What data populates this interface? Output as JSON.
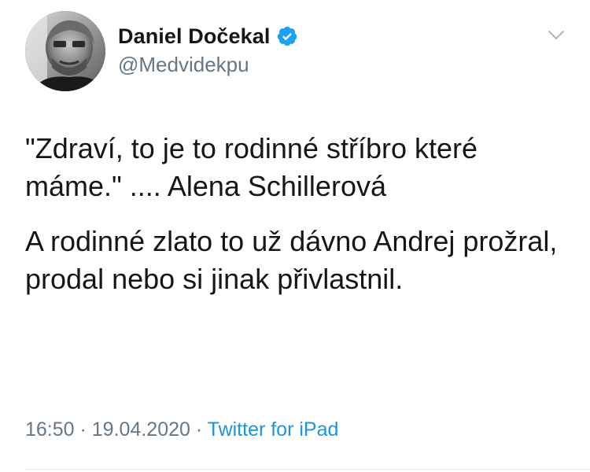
{
  "author": {
    "display_name": "Daniel Dočekal",
    "handle": "@Medvidekpu",
    "verified": true
  },
  "icons": {
    "verified": "verified-badge-icon",
    "menu": "chevron-down-icon"
  },
  "tweet": {
    "paragraph_1": "\"Zdraví, to je to rodinné stříbro které máme.\" .... Alena Schillerová",
    "paragraph_2": "A rodinné zlato to už dávno Andrej prožral, prodal nebo si jinak přivlastnil."
  },
  "meta": {
    "time": "16:50",
    "separator_1": " · ",
    "date": "19.04.2020",
    "separator_2": " · ",
    "source": "Twitter for iPad"
  },
  "colors": {
    "text": "#14171a",
    "secondary": "#657786",
    "link": "#1b95e0",
    "verified": "#1da1f2",
    "divider": "#e1e8ed"
  }
}
